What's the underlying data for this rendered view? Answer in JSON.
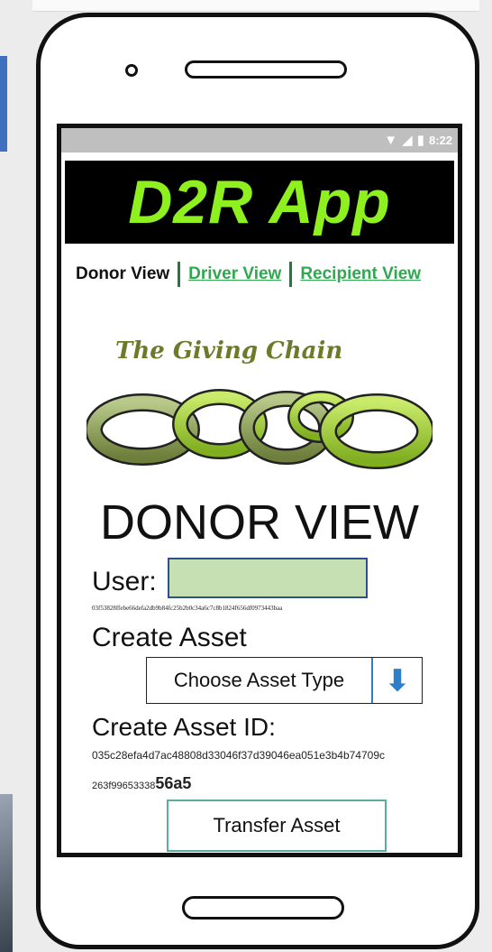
{
  "status_bar": {
    "time": "8:22",
    "icons": [
      "wifi-icon",
      "signal-icon",
      "battery-icon"
    ]
  },
  "app": {
    "title": "D2R App",
    "title_color": "#8ef01f"
  },
  "nav": {
    "items": [
      {
        "label": "Donor View",
        "active": true
      },
      {
        "label": "Driver View",
        "active": false
      },
      {
        "label": "Recipient View",
        "active": false
      }
    ],
    "link_color": "#2fa84f"
  },
  "tagline": "The Giving Chain",
  "view_title": "DONOR VIEW",
  "user": {
    "label": "User:",
    "value": "",
    "hash": "03f53828ffebe66defa2db9b84fc25b2b0c34a6c7c8b1824f656df0973443baa"
  },
  "create_asset": {
    "label": "Create Asset",
    "select_value": "Choose Asset Type"
  },
  "asset_id": {
    "label": "Create Asset ID:",
    "hash_line1": "035c28efa4d7ac48808d33046f37d39046ea051e3b4b74709c",
    "hash_line2_prefix": "263f99653338",
    "hash_line2_suffix": "56a5"
  },
  "transfer_button": "Transfer Asset"
}
